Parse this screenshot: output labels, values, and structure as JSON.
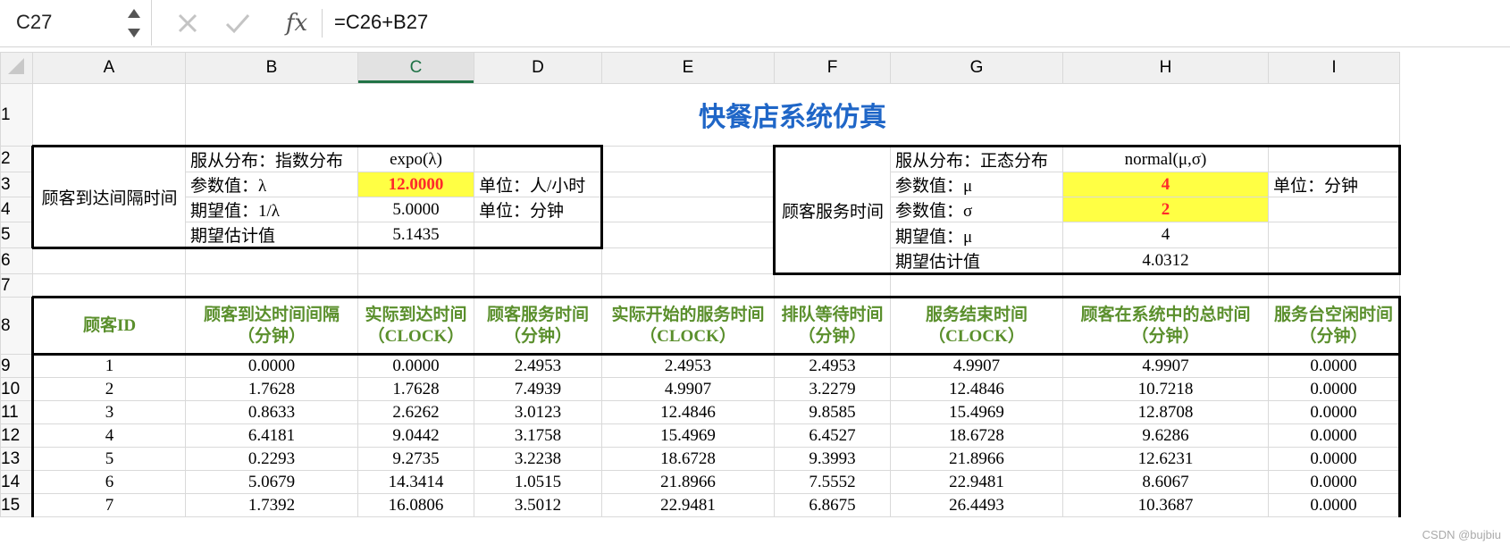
{
  "formula_bar": {
    "name_box": "C27",
    "fx_label": "fx",
    "formula": "=C26+B27"
  },
  "columns": [
    "A",
    "B",
    "C",
    "D",
    "E",
    "F",
    "G",
    "H",
    "I"
  ],
  "rows": [
    "1",
    "2",
    "3",
    "4",
    "5",
    "6",
    "7",
    "8",
    "9",
    "10",
    "11",
    "12",
    "13",
    "14",
    "15"
  ],
  "title": "快餐店系统仿真",
  "arrival": {
    "label": "顾客到达间隔时间",
    "dist_label": "服从分布：指数分布",
    "dist_formula": "expo(λ)",
    "param_label": "参数值：λ",
    "param_value": "12.0000",
    "param_unit": "单位：人/小时",
    "expect_label": "期望值：1/λ",
    "expect_value": "5.0000",
    "expect_unit": "单位：分钟",
    "estimate_label": "期望估计值",
    "estimate_value": "5.1435"
  },
  "service": {
    "label": "顾客服务时间",
    "dist_label": "服从分布：正态分布",
    "dist_formula": "normal(μ,σ)",
    "mu_label": "参数值：μ",
    "mu_value": "4",
    "mu_unit": "单位：分钟",
    "sigma_label": "参数值：σ",
    "sigma_value": "2",
    "expect_label": "期望值：μ",
    "expect_value": "4",
    "estimate_label": "期望估计值",
    "estimate_value": "4.0312"
  },
  "sim_headers": [
    {
      "l1": "顾客ID",
      "l2": ""
    },
    {
      "l1": "顾客到达时间间隔",
      "l2": "（分钟）"
    },
    {
      "l1": "实际到达时间",
      "l2": "（CLOCK）"
    },
    {
      "l1": "顾客服务时间",
      "l2": "（分钟）"
    },
    {
      "l1": "实际开始的服务时间",
      "l2": "（CLOCK）"
    },
    {
      "l1": "排队等待时间",
      "l2": "（分钟）"
    },
    {
      "l1": "服务结束时间",
      "l2": "（CLOCK）"
    },
    {
      "l1": "顾客在系统中的总时间",
      "l2": "（分钟）"
    },
    {
      "l1": "服务台空闲时间",
      "l2": "（分钟）"
    }
  ],
  "sim_rows": [
    [
      "1",
      "0.0000",
      "0.0000",
      "2.4953",
      "2.4953",
      "2.4953",
      "4.9907",
      "4.9907",
      "0.0000"
    ],
    [
      "2",
      "1.7628",
      "1.7628",
      "7.4939",
      "4.9907",
      "3.2279",
      "12.4846",
      "10.7218",
      "0.0000"
    ],
    [
      "3",
      "0.8633",
      "2.6262",
      "3.0123",
      "12.4846",
      "9.8585",
      "15.4969",
      "12.8708",
      "0.0000"
    ],
    [
      "4",
      "6.4181",
      "9.0442",
      "3.1758",
      "15.4969",
      "6.4527",
      "18.6728",
      "9.6286",
      "0.0000"
    ],
    [
      "5",
      "0.2293",
      "9.2735",
      "3.2238",
      "18.6728",
      "9.3993",
      "21.8966",
      "12.6231",
      "0.0000"
    ],
    [
      "6",
      "5.0679",
      "14.3414",
      "1.0515",
      "21.8966",
      "7.5552",
      "22.9481",
      "8.6067",
      "0.0000"
    ],
    [
      "7",
      "1.7392",
      "16.0806",
      "3.5012",
      "22.9481",
      "6.8675",
      "26.4493",
      "10.3687",
      "0.0000"
    ]
  ],
  "watermark": "CSDN @bujbiu",
  "colors": {
    "title": "#1f66c7",
    "header_green": "#5a8f2c",
    "highlight": "#ffff44",
    "param_red": "#ff2a2a",
    "accent": "#217346"
  }
}
